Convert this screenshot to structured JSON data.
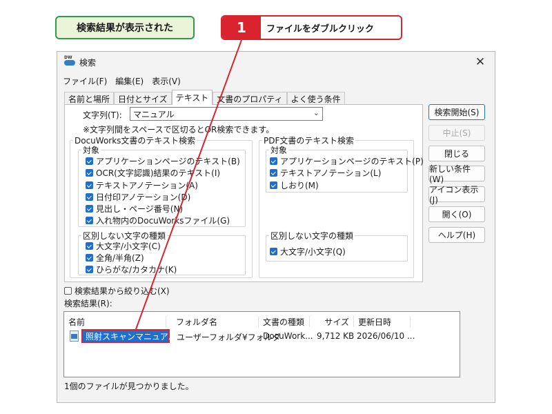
{
  "callouts": {
    "result_shown": "検索結果が表示された",
    "step_number": "1",
    "step_text": "ファイルをダブルクリック"
  },
  "window": {
    "title": "検索",
    "app_icon_text": "DW",
    "close_symbol": "✕"
  },
  "menu": [
    "ファイル(F)",
    "編集(E)",
    "表示(V)"
  ],
  "tabs": [
    "名前と場所",
    "日付とサイズ",
    "テキスト",
    "文書のプロパティ",
    "よく使う条件"
  ],
  "active_tab": "テキスト",
  "text_tab": {
    "string_label": "文字列(T):",
    "string_value": "マニュアル",
    "hint": "※文字列間をスペースで区切るとOR検索できます。",
    "docuworks_group": {
      "title": "DocuWorks文書のテキスト検索",
      "target_title": "対象",
      "targets": [
        {
          "label": "アプリケーションページのテキスト(B)",
          "checked": true
        },
        {
          "label": "OCR(文字認識)結果のテキスト(I)",
          "checked": true
        },
        {
          "label": "テキストアノテーション(A)",
          "checked": true
        },
        {
          "label": "日付印アノテーション(D)",
          "checked": true
        },
        {
          "label": "見出し・ページ番号(N)",
          "checked": true
        },
        {
          "label": "入れ物内のDocuWorksファイル(G)",
          "checked": true
        }
      ],
      "ignore_title": "区別しない文字の種類",
      "ignore": [
        {
          "label": "大文字/小文字(C)",
          "checked": true
        },
        {
          "label": "全角/半角(Z)",
          "checked": true
        },
        {
          "label": "ひらがな/カタカナ(K)",
          "checked": true
        }
      ]
    },
    "pdf_group": {
      "title": "PDF文書のテキスト検索",
      "target_title": "対象",
      "targets": [
        {
          "label": "アプリケーションページのテキスト(P)",
          "checked": true
        },
        {
          "label": "テキストアノテーション(L)",
          "checked": true
        },
        {
          "label": "しおり(M)",
          "checked": true
        }
      ],
      "ignore_title": "区別しない文字の種類",
      "ignore": [
        {
          "label": "大文字/小文字(Q)",
          "checked": true
        }
      ]
    }
  },
  "buttons": [
    "検索開始(S)",
    "中止(S)",
    "閉じる",
    "新しい条件(W)",
    "アイコン表示(J)",
    "開く(O)",
    "ヘルプ(H)"
  ],
  "narrow_label": "検索結果から絞り込む(X)",
  "narrow_checked": false,
  "results_label": "検索結果(R):",
  "results": {
    "columns": [
      "名前",
      "フォルダ名",
      "文書の種類",
      "サイズ",
      "更新日時"
    ],
    "rows": [
      {
        "name": "照射スキャンマニュアル...",
        "folder": "ユーザーフォルダ¥フォルダ",
        "type": "DocuWork...",
        "size": "9,712 KB",
        "date": "2026/06/10 ..."
      }
    ]
  },
  "status": "1個のファイルが見つかりました。",
  "colors": {
    "accent": "#1f6fcf",
    "callout_red": "#d9232e",
    "callout_green": "#2e9a4c"
  }
}
